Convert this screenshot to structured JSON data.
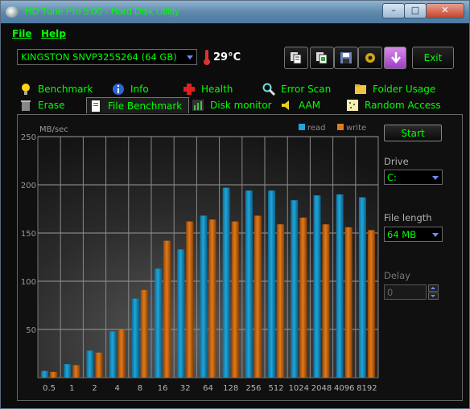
{
  "window": {
    "title": "HD Tune Pro 5.00 - Hard Disk Utility",
    "minimize": "–",
    "maximize": "□",
    "close": "✕"
  },
  "menu": {
    "file": "File",
    "help": "Help"
  },
  "toolbar": {
    "drive": "KINGSTON SNVP325S264 (64 GB)",
    "temperature": "29°C",
    "exit_label": "Exit",
    "icons": [
      "copy-text-icon",
      "copy-screenshot-icon",
      "save-icon",
      "options-icon",
      "download-icon"
    ]
  },
  "tabs": {
    "row1": [
      {
        "label": "Benchmark",
        "icon": "lightbulb-icon"
      },
      {
        "label": "Info",
        "icon": "info-icon"
      },
      {
        "label": "Health",
        "icon": "cross-icon"
      },
      {
        "label": "Error Scan",
        "icon": "magnifier-icon"
      },
      {
        "label": "Folder Usage",
        "icon": "folder-icon"
      }
    ],
    "row2": [
      {
        "label": "Erase",
        "icon": "trash-icon"
      },
      {
        "label": "File Benchmark",
        "icon": "document-icon",
        "active": true
      },
      {
        "label": "Disk monitor",
        "icon": "bars-icon"
      },
      {
        "label": "AAM",
        "icon": "speaker-icon"
      },
      {
        "label": "Random Access",
        "icon": "dots-icon"
      }
    ]
  },
  "controls": {
    "start": "Start",
    "drive_label": "Drive",
    "drive_value": "C:",
    "file_length_label": "File length",
    "file_length_value": "64 MB",
    "delay_label": "Delay",
    "delay_value": "0"
  },
  "colors": {
    "read": "#1fa6d8",
    "write": "#e07a1a",
    "text_green": "#00ff00"
  },
  "chart_data": {
    "type": "bar",
    "ylabel": "MB/sec",
    "ylim": [
      0,
      250
    ],
    "yticks": [
      50,
      100,
      150,
      200,
      250
    ],
    "categories": [
      "0.5",
      "1",
      "2",
      "4",
      "8",
      "16",
      "32",
      "64",
      "128",
      "256",
      "512",
      "1024",
      "2048",
      "4096",
      "8192"
    ],
    "series": [
      {
        "name": "read",
        "values": [
          7,
          14,
          28,
          48,
          82,
          113,
          133,
          168,
          197,
          194,
          194,
          184,
          189,
          190,
          187
        ]
      },
      {
        "name": "write",
        "values": [
          6,
          13,
          26,
          50,
          91,
          142,
          162,
          164,
          162,
          168,
          159,
          166,
          159,
          156,
          153
        ]
      }
    ],
    "legend_position": "top-right",
    "grid": true
  }
}
